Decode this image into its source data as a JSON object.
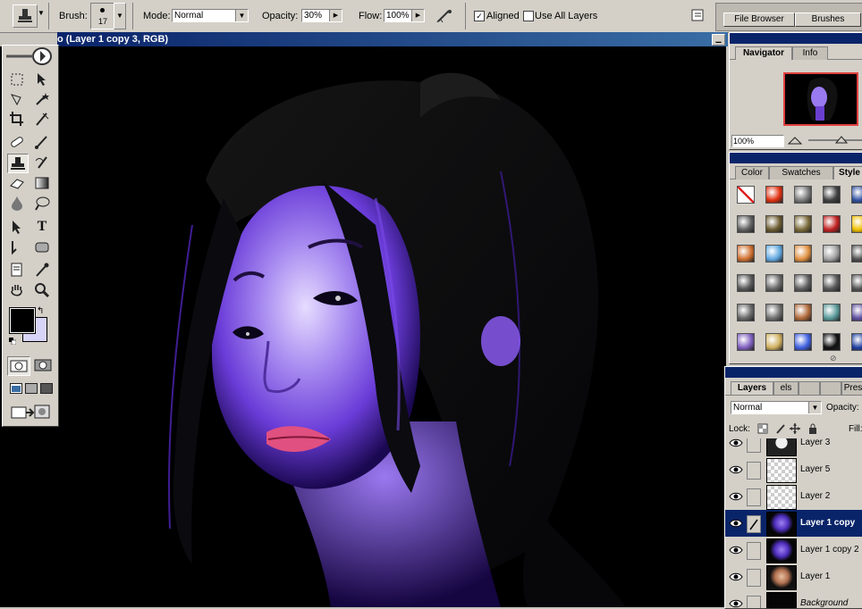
{
  "options_bar": {
    "brush_label": "Brush:",
    "brush_size": "17",
    "mode_label": "Mode:",
    "mode_value": "Normal",
    "opacity_label": "Opacity:",
    "opacity_value": "30%",
    "flow_label": "Flow:",
    "flow_value": "100%",
    "aligned_check": "✓",
    "aligned_label": "Aligned",
    "use_all_layers_label": "Use All Layers",
    "palette_tabs": [
      "File Browser",
      "Brushes"
    ]
  },
  "document": {
    "title": "o (Layer 1 copy 3, RGB)",
    "minimize_glyph": "▁"
  },
  "toolbox": {
    "type_glyph": "T"
  },
  "navigator": {
    "tabs": [
      "Navigator",
      "Info"
    ],
    "zoom_value": "100%"
  },
  "color_panel": {
    "tabs": [
      "Color",
      "Swatches",
      "Style"
    ],
    "styles": [
      {
        "icon": "none-style-icon",
        "color": "#ffffff"
      },
      {
        "icon": "red-glow-style-icon",
        "color": "#e03010"
      },
      {
        "icon": "gray-button-style-icon",
        "color": "#7a7a7a"
      },
      {
        "icon": "dark-bevel-style-icon",
        "color": "#404040"
      },
      {
        "icon": "blue-bars-style-icon",
        "color": "#3050a0"
      },
      {
        "icon": "chrome-style-icon",
        "color": "#606060"
      },
      {
        "icon": "olive-style-icon",
        "color": "#6a5a30"
      },
      {
        "icon": "olive2-style-icon",
        "color": "#7a6a3a"
      },
      {
        "icon": "red-rect-style-icon",
        "color": "#c02020"
      },
      {
        "icon": "rainbow-style-icon",
        "color": "#f0c000"
      },
      {
        "icon": "orange-gradient-style-icon",
        "color": "#d07030"
      },
      {
        "icon": "blue-glass-style-icon",
        "color": "#60a8e0"
      },
      {
        "icon": "sunset-style-icon",
        "color": "#e09040"
      },
      {
        "icon": "stamp-style-icon",
        "color": "#a0a0a0"
      },
      {
        "icon": "gray-dark-style-icon",
        "color": "#505050"
      },
      {
        "icon": "gray2-style-icon",
        "color": "#5a5a5a"
      },
      {
        "icon": "gray3-style-icon",
        "color": "#6a6a6a"
      },
      {
        "icon": "gray4-style-icon",
        "color": "#606060"
      },
      {
        "icon": "gray5-style-icon",
        "color": "#585858"
      },
      {
        "icon": "gray6-style-icon",
        "color": "#555555"
      },
      {
        "icon": "gray7-style-icon",
        "color": "#6a6a6a"
      },
      {
        "icon": "gray8-style-icon",
        "color": "#707070"
      },
      {
        "icon": "brick-style-icon",
        "color": "#b06a3a"
      },
      {
        "icon": "teal-style-icon",
        "color": "#5a9a9a"
      },
      {
        "icon": "purple-style-icon",
        "color": "#6050a0"
      },
      {
        "icon": "violet-style-icon",
        "color": "#8060c0"
      },
      {
        "icon": "gold-style-icon",
        "color": "#d0b060"
      },
      {
        "icon": "spectrum-style-icon",
        "color": "#4060e0"
      },
      {
        "icon": "black-style-icon",
        "color": "#101010"
      },
      {
        "icon": "cobalt-style-icon",
        "color": "#2040a0"
      }
    ]
  },
  "layers_panel": {
    "tabs": [
      "Layers",
      "els",
      "",
      "",
      "Pres"
    ],
    "blend_mode": "Normal",
    "opacity_label": "Opacity:",
    "lock_label": "Lock:",
    "fill_label": "Fill:",
    "layers": [
      {
        "name": "Layer 3",
        "thumb": "face",
        "selected": false,
        "italic": false
      },
      {
        "name": "Layer 5",
        "thumb": "checker",
        "selected": false,
        "italic": false
      },
      {
        "name": "Layer 2",
        "thumb": "checker",
        "selected": false,
        "italic": false
      },
      {
        "name": "Layer 1 copy",
        "thumb": "purple",
        "selected": true,
        "italic": false
      },
      {
        "name": "Layer 1 copy 2",
        "thumb": "purple",
        "selected": false,
        "italic": false
      },
      {
        "name": "Layer 1",
        "thumb": "skin",
        "selected": false,
        "italic": false
      },
      {
        "name": "Background",
        "thumb": "black",
        "selected": false,
        "italic": true
      }
    ]
  },
  "colors": {
    "foreground": "#000000",
    "background": "#d8d4f8",
    "accent": "#0a246a"
  }
}
